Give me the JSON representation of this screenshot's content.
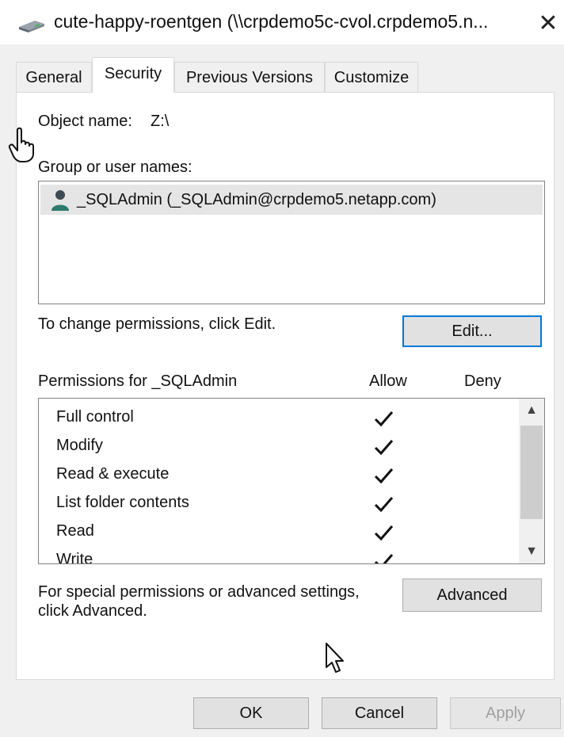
{
  "window": {
    "title": "cute-happy-roentgen (\\\\crpdemo5c-cvol.crpdemo5.n...",
    "close_glyph": "✕",
    "icon": "network-drive-icon"
  },
  "tabs": [
    {
      "label": "General",
      "active": false
    },
    {
      "label": "Security",
      "active": true
    },
    {
      "label": "Previous Versions",
      "active": false
    },
    {
      "label": "Customize",
      "active": false
    }
  ],
  "security": {
    "object_name_label": "Object name:",
    "object_name_value": "Z:\\",
    "group_label": "Group or user names:",
    "users": [
      {
        "name": "_SQLAdmin (_SQLAdmin@crpdemo5.netapp.com)",
        "icon": "user-icon",
        "selected": true
      }
    ],
    "change_hint": "To change permissions, click Edit.",
    "edit_button": "Edit...",
    "permissions_label": "Permissions for _SQLAdmin",
    "allow_header": "Allow",
    "deny_header": "Deny",
    "permissions": [
      {
        "name": "Full control",
        "allow": true,
        "deny": false
      },
      {
        "name": "Modify",
        "allow": true,
        "deny": false
      },
      {
        "name": "Read & execute",
        "allow": true,
        "deny": false
      },
      {
        "name": "List folder contents",
        "allow": true,
        "deny": false
      },
      {
        "name": "Read",
        "allow": true,
        "deny": false
      },
      {
        "name": "Write",
        "allow": true,
        "deny": false
      }
    ],
    "advanced_hint_line1": "For special permissions or advanced settings,",
    "advanced_hint_line2": "click Advanced.",
    "advanced_button": "Advanced"
  },
  "footer": {
    "ok": "OK",
    "cancel": "Cancel",
    "apply": "Apply",
    "apply_enabled": false
  },
  "colors": {
    "focus_border": "#0078d7",
    "selection_bg": "#e5e5e5",
    "dialog_bg": "#f0f0f0"
  }
}
